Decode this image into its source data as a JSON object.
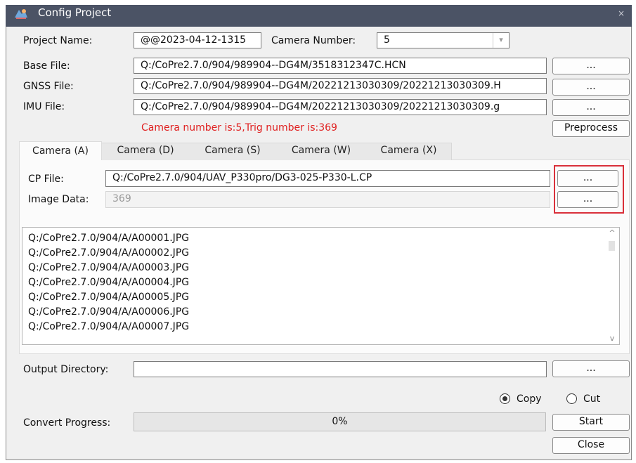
{
  "window": {
    "title": "Config Project",
    "close_glyph": "×"
  },
  "project": {
    "name_label": "Project Name:",
    "name_value": "@@2023-04-12-1315",
    "camera_number_label": "Camera Number:",
    "camera_number_value": "5",
    "dropdown_glyph": "▾"
  },
  "files": {
    "base_label": "Base File:",
    "base_value": "Q:/CoPre2.7.0/904/989904--DG4M/3518312347C.HCN",
    "gnss_label": "GNSS File:",
    "gnss_value": "Q:/CoPre2.7.0/904/989904--DG4M/20221213030309/20221213030309.H",
    "imu_label": "IMU File:",
    "imu_value": "Q:/CoPre2.7.0/904/989904--DG4M/20221213030309/20221213030309.g",
    "browse_label": "...",
    "preprocess_label": "Preprocess"
  },
  "status_message": "Camera number is:5,Trig number is:369",
  "colors": {
    "titlebar": "#4b5365",
    "status_red": "#e02020",
    "highlight_red": "#d9303a"
  },
  "tabs": [
    {
      "label": "Camera (A)",
      "active": true
    },
    {
      "label": "Camera (D)",
      "active": false
    },
    {
      "label": "Camera (S)",
      "active": false
    },
    {
      "label": "Camera (W)",
      "active": false
    },
    {
      "label": "Camera (X)",
      "active": false
    }
  ],
  "camera_panel": {
    "cp_label": "CP File:",
    "cp_value": "Q:/CoPre2.7.0/904/UAV_P330pro/DG3-025-P330-L.CP",
    "image_label": "Image Data:",
    "image_value": "369",
    "browse_label": "..."
  },
  "image_list": [
    "Q:/CoPre2.7.0/904/A/A00001.JPG",
    "Q:/CoPre2.7.0/904/A/A00002.JPG",
    "Q:/CoPre2.7.0/904/A/A00003.JPG",
    "Q:/CoPre2.7.0/904/A/A00004.JPG",
    "Q:/CoPre2.7.0/904/A/A00005.JPG",
    "Q:/CoPre2.7.0/904/A/A00006.JPG",
    "Q:/CoPre2.7.0/904/A/A00007.JPG"
  ],
  "scroll": {
    "up_glyph": "^",
    "down_glyph": "v"
  },
  "output": {
    "label": "Output Directory:",
    "value": "",
    "browse_label": "..."
  },
  "mode": {
    "copy_label": "Copy",
    "cut_label": "Cut",
    "selected": "copy"
  },
  "progress": {
    "label": "Convert Progress:",
    "value_text": "0%",
    "value": 0
  },
  "actions": {
    "start_label": "Start",
    "close_label": "Close"
  }
}
